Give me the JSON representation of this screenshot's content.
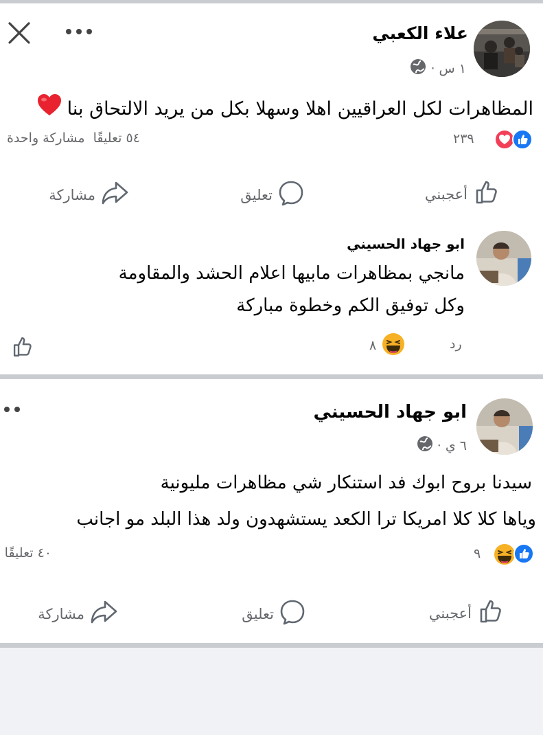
{
  "post1": {
    "author": "علاء الكعبي",
    "time": "١ س ·",
    "text": "المظاهرات لكل العراقيين اهلا وسهلا بكل من يريد الالتحاق بنا",
    "reaction_count": "٢٣٩",
    "stats": "٥٤ تعليقًا  مشاركة واحدة",
    "actions": {
      "like": "أعجبني",
      "comment": "تعليق",
      "share": "مشاركة"
    }
  },
  "comment1": {
    "author": "ابو جهاد الحسيني",
    "line1": "مانجي بمظاهرات مابيها اعلام الحشد والمقاومة",
    "line2": "وكل توفيق الكم وخطوة مباركة",
    "reply": "رد",
    "reaction_count": "٨"
  },
  "post2": {
    "author": "ابو جهاد الحسيني",
    "time": "٦ ي ·",
    "line1": "سيدنا بروح ابوك فد استنكار شي مظاهرات مليونية",
    "line2": "وياها كلا كلا امريكا ترا الكعد يستشهدون ولد هذا البلد مو اجانب",
    "reaction_count": "٩",
    "stats": "٤٠ تعليقًا",
    "actions": {
      "like": "أعجبني",
      "comment": "تعليق",
      "share": "مشاركة"
    }
  },
  "colors": {
    "like_blue": "#1877f2",
    "love_red": "#f33e58",
    "haha_yellow": "#f7b125",
    "text": "#050505",
    "muted": "#65676b"
  }
}
